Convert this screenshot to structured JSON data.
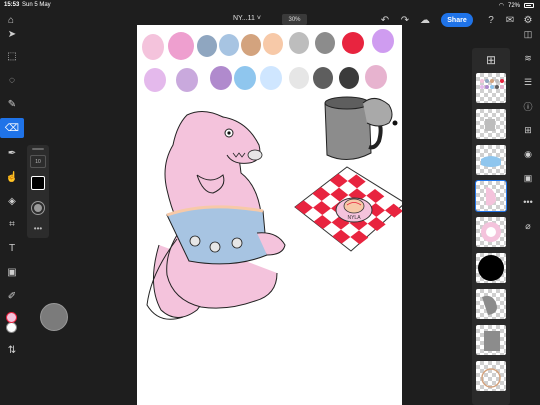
{
  "status_bar": {
    "time": "15:53",
    "date": "Sun 5 May",
    "battery": "72%"
  },
  "header": {
    "doc_title": "NY...11 ˅",
    "zoom": "30%",
    "share_label": "Share"
  },
  "brush_panel": {
    "size_value": "10"
  },
  "colors": {
    "accent": "#1f73e8",
    "foreground": "#000000",
    "background": "#ffffff",
    "palette": [
      "#f4c3dc",
      "#ee9fcf",
      "#8fa6c0",
      "#a7c4e2",
      "#d3a37e",
      "#f7c9a8",
      "#bdbdbd",
      "#8c8c8c",
      "#e8243f",
      "#cf9cf0",
      "#e4b9ec",
      "#c9a9dd",
      "#b08acd",
      "#8fc6ee",
      "#cfe6ff",
      "#e6e6e6",
      "#5e5e5e",
      "#3b3b3b",
      "#e7b3cf"
    ]
  },
  "tools_left": [
    "move-icon",
    "transform-icon",
    "lasso-icon",
    "brush-icon",
    "eraser-icon",
    "eyedropper-icon",
    "smudge-icon",
    "fill-icon",
    "crop-icon",
    "text-icon",
    "image-icon",
    "color-picker-icon"
  ],
  "tools_right": [
    "layers-icon",
    "layer-properties-icon",
    "adjustments-icon",
    "info-icon",
    "add-layer-icon",
    "visibility-icon",
    "mask-icon",
    "more-icon",
    "clear-icon"
  ],
  "layer_count": 9,
  "selected_layer_index": 3,
  "illustration": {
    "bowl_text": "NYLA"
  }
}
